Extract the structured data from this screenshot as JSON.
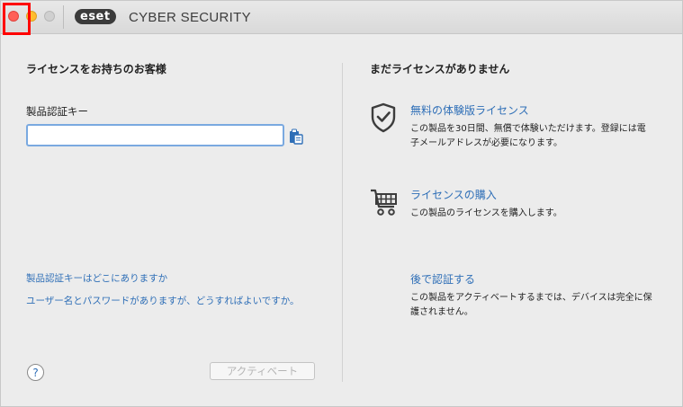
{
  "titlebar": {
    "logo_text": "eset",
    "app_title": "CYBER SECURITY"
  },
  "left": {
    "heading": "ライセンスをお持ちのお客様",
    "key_label": "製品認証キー",
    "key_value": "",
    "link_where_key": "製品認証キーはどこにありますか",
    "link_user_pass": "ユーザー名とパスワードがありますが、どうすればよいですか。",
    "help_label": "?",
    "activate_label": "アクティベート"
  },
  "right": {
    "heading": "まだライセンスがありません",
    "options": [
      {
        "icon": "shield-check-icon",
        "title": "無料の体験版ライセンス",
        "desc_line1": "この製品を30日間、無償で体験いただけます。登録には電",
        "desc_line2": "子メールアドレスが必要になります。"
      },
      {
        "icon": "shopping-cart-icon",
        "title": "ライセンスの購入",
        "desc_line1": "この製品のライセンスを購入します。"
      },
      {
        "title": "後で認証する",
        "desc_line1": "この製品をアクティベートするまでは、デバイスは完全に保",
        "desc_line2": "護されません。"
      }
    ]
  },
  "colors": {
    "link": "#2f6fb7",
    "close": "#ff5f57",
    "minimize": "#ffbd2e",
    "highlight": "#ff0000"
  }
}
